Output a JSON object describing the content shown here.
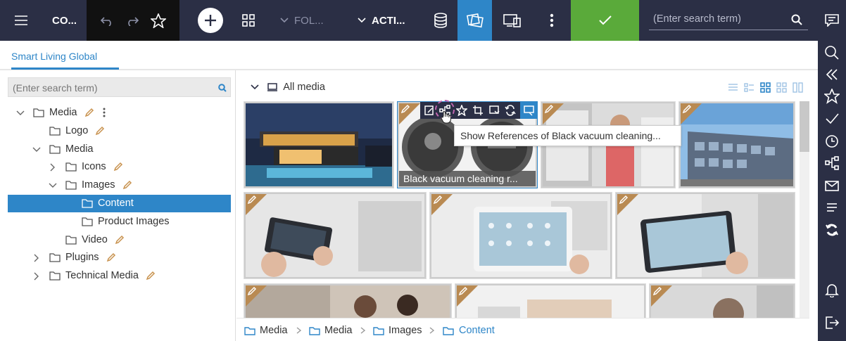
{
  "topbar": {
    "app_title": "CO...",
    "folder_label": "FOL...",
    "actions_label": "ACTI...",
    "search_placeholder": "(Enter search term)",
    "icons": [
      "menu-icon",
      "undo-icon",
      "redo-icon",
      "star-icon",
      "add-icon",
      "grid-icon",
      "chevron-down-icon",
      "database-icon",
      "media-view-icon",
      "devices-icon",
      "more-vertical-icon",
      "check-icon",
      "search-icon",
      "comment-icon"
    ],
    "colors": {
      "bar": "#2b2f45",
      "history": "#111111",
      "active": "#2e86c8",
      "confirm": "#5aaa3a"
    }
  },
  "tabs": [
    {
      "label": "Smart Living Global",
      "active": true
    }
  ],
  "tree": {
    "search_placeholder": "(Enter search term)",
    "items": [
      {
        "label": "Media",
        "level": 0,
        "expanded": true,
        "has_toggle": true,
        "edit": true,
        "more": true
      },
      {
        "label": "Logo",
        "level": 1,
        "has_toggle": false,
        "edit": true
      },
      {
        "label": "Media",
        "level": 1,
        "expanded": true,
        "has_toggle": true,
        "edit": false
      },
      {
        "label": "Icons",
        "level": 2,
        "expanded": false,
        "has_toggle": true,
        "edit": true
      },
      {
        "label": "Images",
        "level": 2,
        "expanded": true,
        "has_toggle": true,
        "edit": true
      },
      {
        "label": "Content",
        "level": 3,
        "selected": true,
        "has_toggle": false,
        "edit": false
      },
      {
        "label": "Product Images",
        "level": 3,
        "has_toggle": false,
        "edit": false
      },
      {
        "label": "Video",
        "level": 2,
        "has_toggle": false,
        "edit": true
      },
      {
        "label": "Plugins",
        "level": 1,
        "expanded": false,
        "has_toggle": true,
        "edit": true
      },
      {
        "label": "Technical Media",
        "level": 1,
        "expanded": false,
        "has_toggle": true,
        "edit": true
      }
    ]
  },
  "main": {
    "header_label": "All media",
    "view_icons": [
      "list-view-icon",
      "detail-view-icon",
      "tile-view-icon",
      "grid-view-icon",
      "split-view-icon"
    ],
    "hovered_caption": "Black vacuum cleaning r...",
    "tooltip": "Show References of Black vacuum cleaning...",
    "tile_toolbar_icons": [
      "edit-icon",
      "references-icon",
      "favorite-icon",
      "crop-icon",
      "download-icon",
      "refresh-icon",
      "preview-icon"
    ]
  },
  "breadcrumb": [
    "Media",
    "Media",
    "Images",
    "Content"
  ],
  "rail_icons": [
    "search-icon",
    "collapse-icon",
    "star-icon",
    "check-icon",
    "clock-icon",
    "references-icon",
    "mail-icon",
    "list-icon",
    "sync-icon",
    "bell-icon",
    "logout-icon"
  ]
}
